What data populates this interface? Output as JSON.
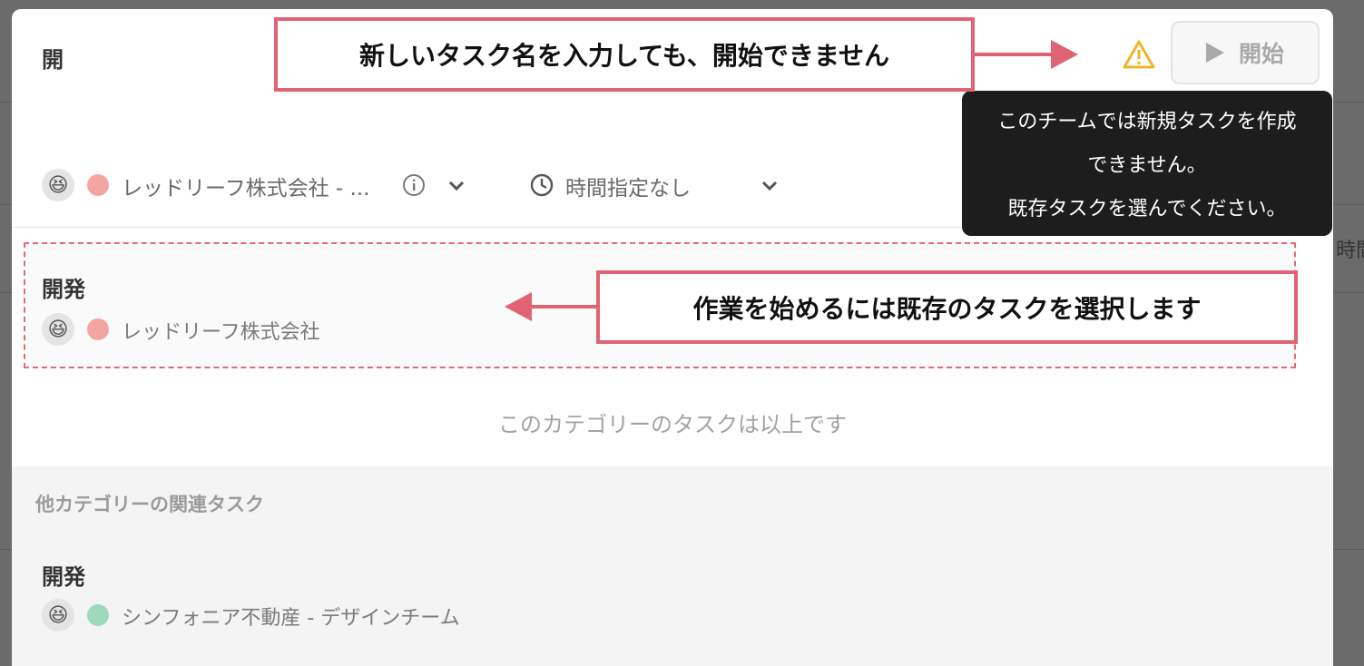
{
  "header": {
    "title": "開"
  },
  "start_button": {
    "label": "開始"
  },
  "meta": {
    "client": "レッドリーフ株式会社 - ...",
    "time": "時間指定なし",
    "client_dot_color": "#f4a5a2"
  },
  "task": {
    "name": "開発",
    "client": "レッドリーフ株式会社"
  },
  "end_note": "このカテゴリーのタスクは以上です",
  "other_section": {
    "title": "他カテゴリーの関連タスク",
    "task": {
      "name": "開発",
      "client": "シンフォニア不動産 - デザインチーム",
      "dot_color": "#9fd9bd"
    }
  },
  "tooltip": {
    "line1": "このチームでは新規タスクを作成",
    "line2": "できません。",
    "line3": "既存タスクを選んでください。"
  },
  "annotations": {
    "top": "新しいタスク名を入力しても、開始できません",
    "middle": "作業を始めるには既存のタスクを選択します"
  },
  "background_peek": "時間"
}
